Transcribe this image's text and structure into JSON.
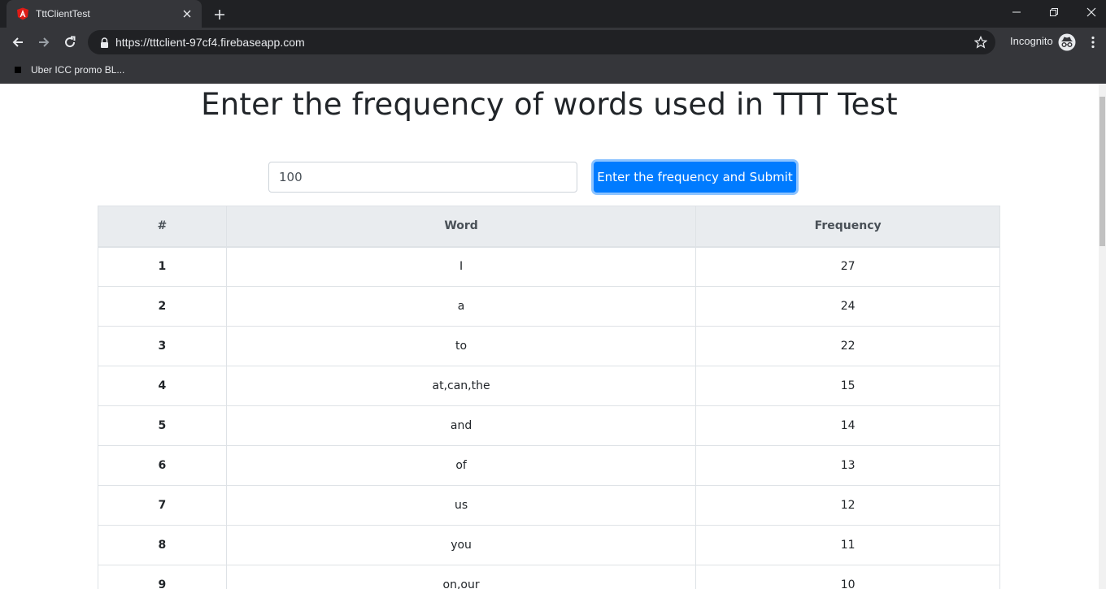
{
  "browser": {
    "tab_title": "TttClientTest",
    "url": "https://tttclient-97cf4.firebaseapp.com",
    "profile_label": "Incognito",
    "bookmarks": [
      {
        "label": "Uber ICC promo BL..."
      }
    ],
    "colors": {
      "titlebar": "#202124",
      "toolbar": "#35363a",
      "favicon": "#dd1b16"
    }
  },
  "page": {
    "title": "Enter the frequency of words used in TTT Test",
    "frequency_input_value": "100",
    "submit_label": "Enter the frequency and Submit",
    "accent_color": "#007bff",
    "table": {
      "headers": [
        "#",
        "Word",
        "Frequency"
      ],
      "rows": [
        {
          "rank": "1",
          "word": "I",
          "frequency": "27"
        },
        {
          "rank": "2",
          "word": "a",
          "frequency": "24"
        },
        {
          "rank": "3",
          "word": "to",
          "frequency": "22"
        },
        {
          "rank": "4",
          "word": "at,can,the",
          "frequency": "15"
        },
        {
          "rank": "5",
          "word": "and",
          "frequency": "14"
        },
        {
          "rank": "6",
          "word": "of",
          "frequency": "13"
        },
        {
          "rank": "7",
          "word": "us",
          "frequency": "12"
        },
        {
          "rank": "8",
          "word": "you",
          "frequency": "11"
        },
        {
          "rank": "9",
          "word": "on,our",
          "frequency": "10"
        }
      ]
    }
  }
}
